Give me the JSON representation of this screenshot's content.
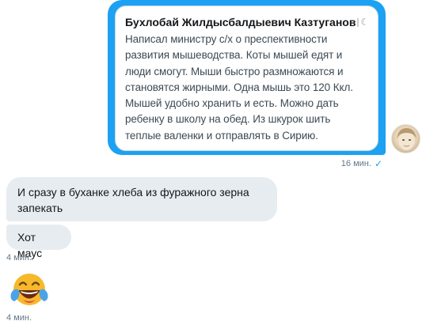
{
  "outgoing": {
    "quote": {
      "author": "Бухлобай Жилдысбалдыевич Казтуганов",
      "flag_icon": "russia-flag-icon",
      "more_icon": "more-icon",
      "lines": [
        "Написал министру с/х о преспективности",
        "развития мышеводства. Коты мышей едят и",
        "люди смогут. Мыши быстро размножаются и",
        "становятся жирными. Одна мышь это 120 Ккл.",
        "Мышей удобно хранить и есть. Можно дать",
        "ребенку в школу на обед. Из шкурок шить",
        "теплые валенки и отправлять в Сирию."
      ]
    },
    "time": "16 мин.",
    "status_icon": "check-icon",
    "bubble_color": "#1da1f2"
  },
  "incoming": {
    "messages": [
      {
        "lines": [
          "И сразу в буханке хлеба из фуражного зерна",
          "запекать"
        ]
      },
      {
        "lines": [
          "Хот маус"
        ]
      }
    ],
    "time_1": "4 мин.",
    "emoji": "face-with-tears-of-joy-icon",
    "time_2": "4 мин.",
    "bubble_color": "#e6ecf0"
  }
}
